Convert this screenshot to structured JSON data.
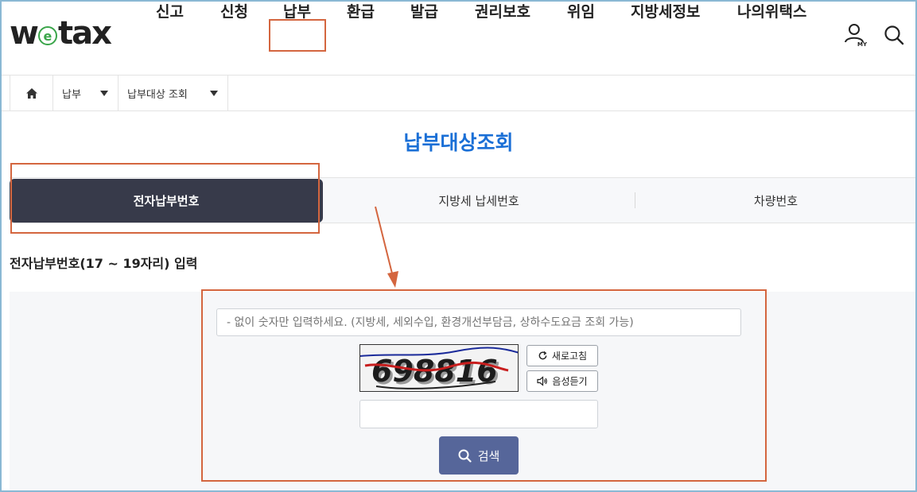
{
  "logo": {
    "before": "w",
    "circle": "e",
    "after": "tax"
  },
  "nav": {
    "items": [
      "신고",
      "신청",
      "납부",
      "환급",
      "발급",
      "권리보호",
      "위임",
      "지방세정보",
      "나의위택스"
    ],
    "active_index": 2,
    "my_label": "MY"
  },
  "breadcrumb": {
    "home_icon": "home-icon",
    "level1": "납부",
    "level2": "납부대상 조회"
  },
  "page_title": "납부대상조회",
  "tabs": {
    "items": [
      "전자납부번호",
      "지방세 납세번호",
      "차량번호"
    ],
    "active_index": 0
  },
  "section_label": "전자납부번호(17 ~ 19자리) 입력",
  "form": {
    "number_placeholder": "- 없이 숫자만 입력하세요. (지방세, 세외수입, 환경개선부담금, 상하수도요금 조회 가능)",
    "captcha_text": "698816",
    "refresh_label": "새로고침",
    "audio_label": "음성듣기",
    "captcha_value": "",
    "search_label": "검색"
  },
  "colors": {
    "accent_blue": "#1a6fd6",
    "active_tab": "#373a4a",
    "search_button": "#56669a",
    "highlight": "#d4663f",
    "logo_green": "#3aa54a"
  }
}
